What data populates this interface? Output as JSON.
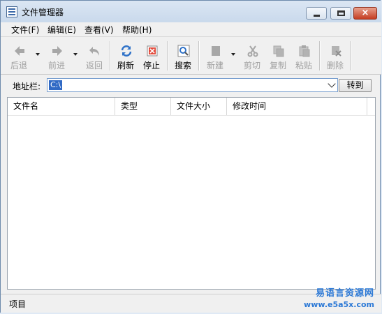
{
  "window": {
    "title": "文件管理器"
  },
  "menu": [
    "文件(F)",
    "编辑(E)",
    "查看(V)",
    "帮助(H)"
  ],
  "toolbar": {
    "back": "后退",
    "forward": "前进",
    "up": "返回",
    "refresh": "刷新",
    "stop": "停止",
    "search": "搜索",
    "new": "新建",
    "cut": "剪切",
    "copy": "复制",
    "paste": "粘贴",
    "delete": "删除"
  },
  "address": {
    "label": "地址栏:",
    "value": "C:\\",
    "go": "转到"
  },
  "list": {
    "columns": [
      "文件名",
      "类型",
      "文件大小",
      "修改时间"
    ],
    "rows": []
  },
  "status": {
    "text": "项目"
  },
  "watermark": {
    "name": "易语言资源网",
    "url": "www.e5a5x.com"
  },
  "colors": {
    "selection": "#316ac5",
    "accent": "#2c79d6",
    "disabled": "#a0a0a0"
  }
}
